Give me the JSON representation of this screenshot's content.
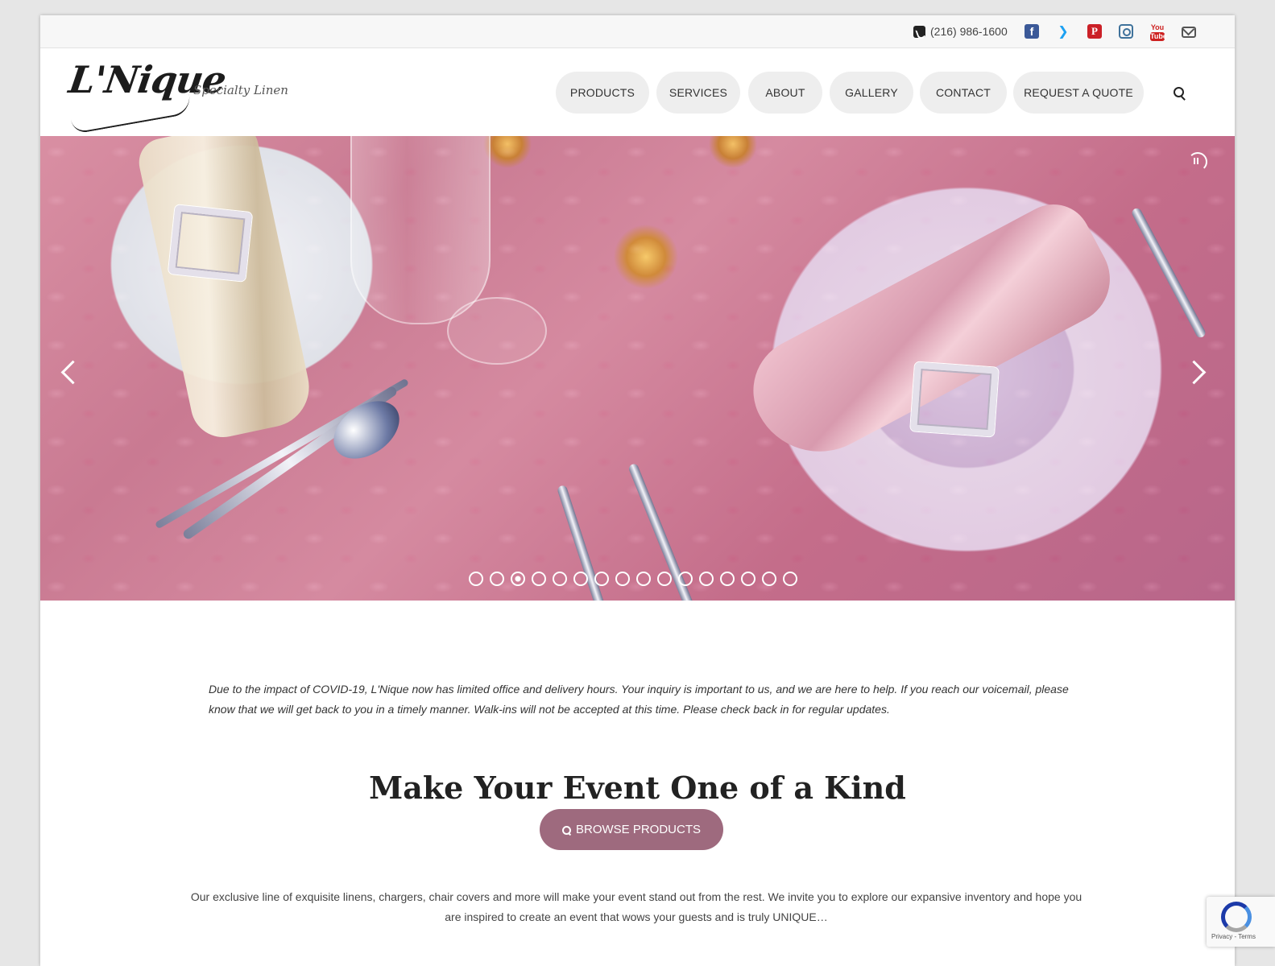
{
  "topbar": {
    "phone": "(216) 986-1600",
    "social": [
      {
        "name": "facebook-icon",
        "glyph": "f",
        "color": "#3b5998"
      },
      {
        "name": "twitter-icon",
        "glyph": "🐦",
        "color": "#1da1f2"
      },
      {
        "name": "pinterest-icon",
        "glyph": "P",
        "color": "#cb2027"
      },
      {
        "name": "instagram-icon",
        "color": "#3f729b"
      },
      {
        "name": "youtube-icon",
        "glyph_top": "You",
        "glyph_bottom": "Tube",
        "color": "#cd201f"
      },
      {
        "name": "email-icon",
        "color": "#555555"
      }
    ]
  },
  "header": {
    "logo": "L'Nique",
    "tagline": "Specialty Linen",
    "nav": [
      {
        "label": "PRODUCTS"
      },
      {
        "label": "SERVICES"
      },
      {
        "label": "ABOUT"
      },
      {
        "label": "GALLERY"
      },
      {
        "label": "CONTACT"
      },
      {
        "label": "REQUEST A QUOTE"
      }
    ]
  },
  "hero": {
    "slide_count": 16,
    "active_slide": 3
  },
  "content": {
    "notice": "Due to the impact of COVID-19, L'Nique now has limited office and delivery hours. Your inquiry is important to us, and we are here to help. If you reach our voicemail, please know that we will get back to you in a timely manner. Walk-ins will not be accepted at this time. Please check back in for regular updates.",
    "headline": "Make Your Event One of a Kind",
    "cta_label": "BROWSE PRODUCTS",
    "intro": "Our exclusive line of exquisite linens, chargers, chair covers and more will make your event stand out from the rest.  We invite you to explore our expansive inventory and hope you are inspired to create an event that wows your guests and is truly UNIQUE…"
  },
  "recaptcha": {
    "legal": "Privacy - Terms"
  },
  "colors": {
    "accent": "#9e6a7e",
    "nav_bg": "#eeeeee",
    "page_bg": "#e6e6e6"
  }
}
